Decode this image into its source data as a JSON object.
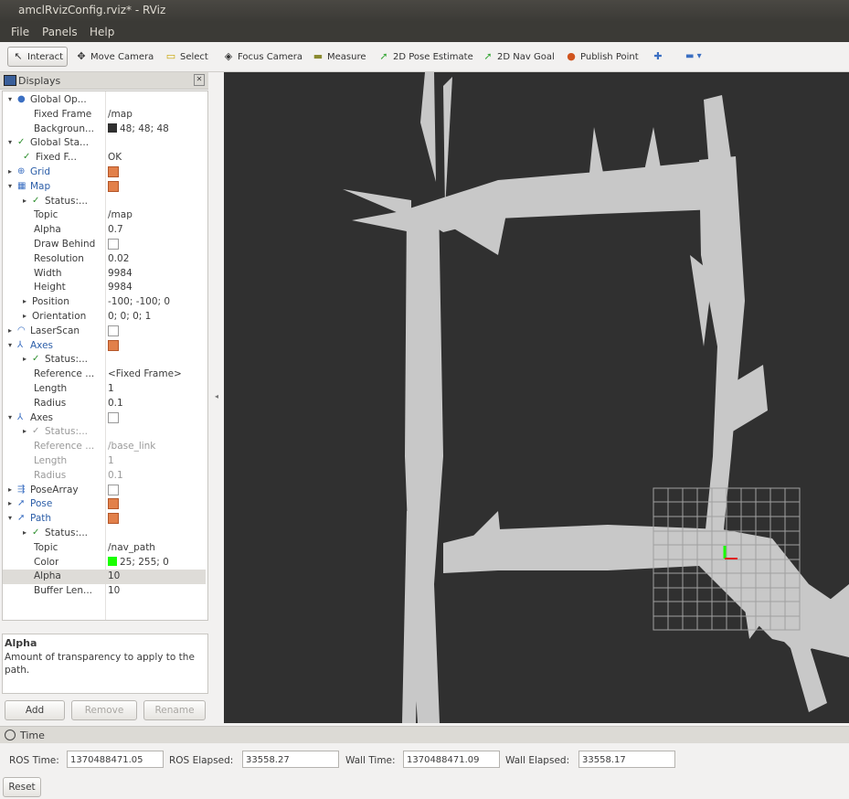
{
  "window": {
    "title": "amclRvizConfig.rviz* - RViz"
  },
  "menu": {
    "items": [
      "File",
      "Panels",
      "Help"
    ]
  },
  "toolbar": {
    "tools": [
      {
        "label": "Interact",
        "icon": "interact-icon",
        "glyph": "↖"
      },
      {
        "label": "Move Camera",
        "icon": "move-camera-icon",
        "glyph": "✥"
      },
      {
        "label": "Select",
        "icon": "select-icon",
        "glyph": "▭"
      },
      {
        "label": "Focus Camera",
        "icon": "focus-camera-icon",
        "glyph": "◈"
      },
      {
        "label": "Measure",
        "icon": "measure-icon",
        "glyph": "▬"
      },
      {
        "label": "2D Pose Estimate",
        "icon": "pose-estimate-icon",
        "glyph": "➚"
      },
      {
        "label": "2D Nav Goal",
        "icon": "nav-goal-icon",
        "glyph": "➚"
      },
      {
        "label": "Publish Point",
        "icon": "publish-point-icon",
        "glyph": "●"
      }
    ],
    "extra": {
      "plus_glyph": "✚",
      "minus_glyph": "▬ ▾"
    }
  },
  "displays": {
    "title": "Displays",
    "rows": [
      {
        "arrow": "▾",
        "icon": "●",
        "name": "Global Op...",
        "value": ""
      },
      {
        "name": "Fixed Frame",
        "value": "/map"
      },
      {
        "name": "Backgroun...",
        "value": "48; 48; 48",
        "swatch": "#303030"
      },
      {
        "arrow": "▾",
        "icon": "✓",
        "name": "Global Sta...",
        "value": ""
      },
      {
        "icon": "✓",
        "name": "Fixed F...",
        "value": "OK"
      },
      {
        "arrow": "▸",
        "icon": "⊕",
        "name": "Grid",
        "value": "",
        "check": true,
        "blue": true
      },
      {
        "arrow": "▾",
        "icon": "▦",
        "name": "Map",
        "value": "",
        "check": true,
        "blue": true
      },
      {
        "arrow": "▸",
        "icon": "✓",
        "name": "Status:...",
        "value": ""
      },
      {
        "name": "Topic",
        "value": "/map"
      },
      {
        "name": "Alpha",
        "value": "0.7"
      },
      {
        "name": "Draw Behind",
        "value": "",
        "check": false
      },
      {
        "name": "Resolution",
        "value": "0.02"
      },
      {
        "name": "Width",
        "value": "9984"
      },
      {
        "name": "Height",
        "value": "9984"
      },
      {
        "arrow": "▸",
        "name": "Position",
        "value": "-100; -100; 0"
      },
      {
        "arrow": "▸",
        "name": "Orientation",
        "value": "0; 0; 0; 1"
      },
      {
        "arrow": "▸",
        "icon": "◠",
        "name": "LaserScan",
        "value": "",
        "check": false
      },
      {
        "arrow": "▾",
        "icon": "⅄",
        "name": "Axes",
        "value": "",
        "check": true,
        "blue": true
      },
      {
        "arrow": "▸",
        "icon": "✓",
        "name": "Status:...",
        "value": ""
      },
      {
        "name": "Reference ...",
        "value": "<Fixed Frame>"
      },
      {
        "name": "Length",
        "value": "1"
      },
      {
        "name": "Radius",
        "value": "0.1"
      },
      {
        "arrow": "▾",
        "icon": "⅄",
        "name": "Axes",
        "value": "",
        "check": false
      },
      {
        "arrow": "▸",
        "icon": "✓",
        "name": "Status:...",
        "value": "",
        "dim": true
      },
      {
        "name": "Reference ...",
        "value": "/base_link",
        "dim": true
      },
      {
        "name": "Length",
        "value": "1",
        "dim": true
      },
      {
        "name": "Radius",
        "value": "0.1",
        "dim": true
      },
      {
        "arrow": "▸",
        "icon": "⇶",
        "name": "PoseArray",
        "value": "",
        "check": false
      },
      {
        "arrow": "▸",
        "icon": "➚",
        "name": "Pose",
        "value": "",
        "check": true,
        "blue": true
      },
      {
        "arrow": "▾",
        "icon": "➚",
        "name": "Path",
        "value": "",
        "check": true,
        "blue": true
      },
      {
        "arrow": "▸",
        "icon": "✓",
        "name": "Status:...",
        "value": ""
      },
      {
        "name": "Topic",
        "value": "/nav_path"
      },
      {
        "name": "Color",
        "value": "25; 255; 0",
        "swatch": "#19ff00"
      },
      {
        "name": "Alpha",
        "value": "10",
        "selected": true
      },
      {
        "name": "Buffer Len...",
        "value": "10"
      }
    ]
  },
  "description": {
    "heading": "Alpha",
    "body": "Amount of transparency to apply to the path."
  },
  "buttons": {
    "add": "Add",
    "remove": "Remove",
    "rename": "Rename"
  },
  "time": {
    "title": "Time",
    "ros_time_label": "ROS Time:",
    "ros_time_value": "1370488471.05",
    "ros_elapsed_label": "ROS Elapsed:",
    "ros_elapsed_value": "33558.27",
    "wall_time_label": "Wall Time:",
    "wall_time_value": "1370488471.09",
    "wall_elapsed_label": "Wall Elapsed:",
    "wall_elapsed_value": "33558.17",
    "reset_label": "Reset"
  },
  "colors": {
    "background": "#303030",
    "map_free": "#c8c8c8",
    "grid": "#a0a0a0",
    "path": "#19ff00",
    "checkbox": "#e2804a"
  }
}
